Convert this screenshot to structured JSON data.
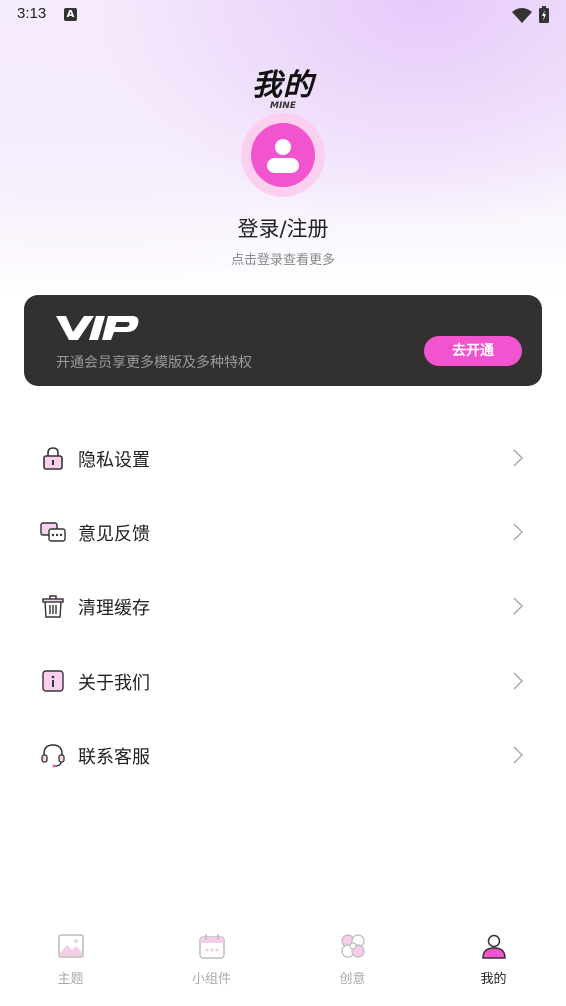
{
  "status_bar": {
    "time": "3:13",
    "notification_glyph": "A"
  },
  "header": {
    "title_cn": "我的",
    "title_en": "MINE"
  },
  "profile": {
    "login_label": "登录/注册",
    "login_hint": "点击登录查看更多"
  },
  "vip": {
    "logo": "VIP",
    "description": "开通会员享更多模版及多种特权",
    "button_label": "去开通"
  },
  "menu": [
    {
      "label": "隐私设置",
      "icon": "lock-icon"
    },
    {
      "label": "意见反馈",
      "icon": "feedback-icon"
    },
    {
      "label": "清理缓存",
      "icon": "trash-icon"
    },
    {
      "label": "关于我们",
      "icon": "info-icon"
    },
    {
      "label": "联系客服",
      "icon": "headset-icon"
    }
  ],
  "tabs": [
    {
      "label": "主题",
      "icon": "image-icon",
      "active": false
    },
    {
      "label": "小组件",
      "icon": "calendar-icon",
      "active": false
    },
    {
      "label": "创意",
      "icon": "flower-icon",
      "active": false
    },
    {
      "label": "我的",
      "icon": "person-icon",
      "active": true
    }
  ],
  "colors": {
    "accent": "#f253cf",
    "accent_light": "#fbd0ef",
    "vip_card": "#333030"
  }
}
